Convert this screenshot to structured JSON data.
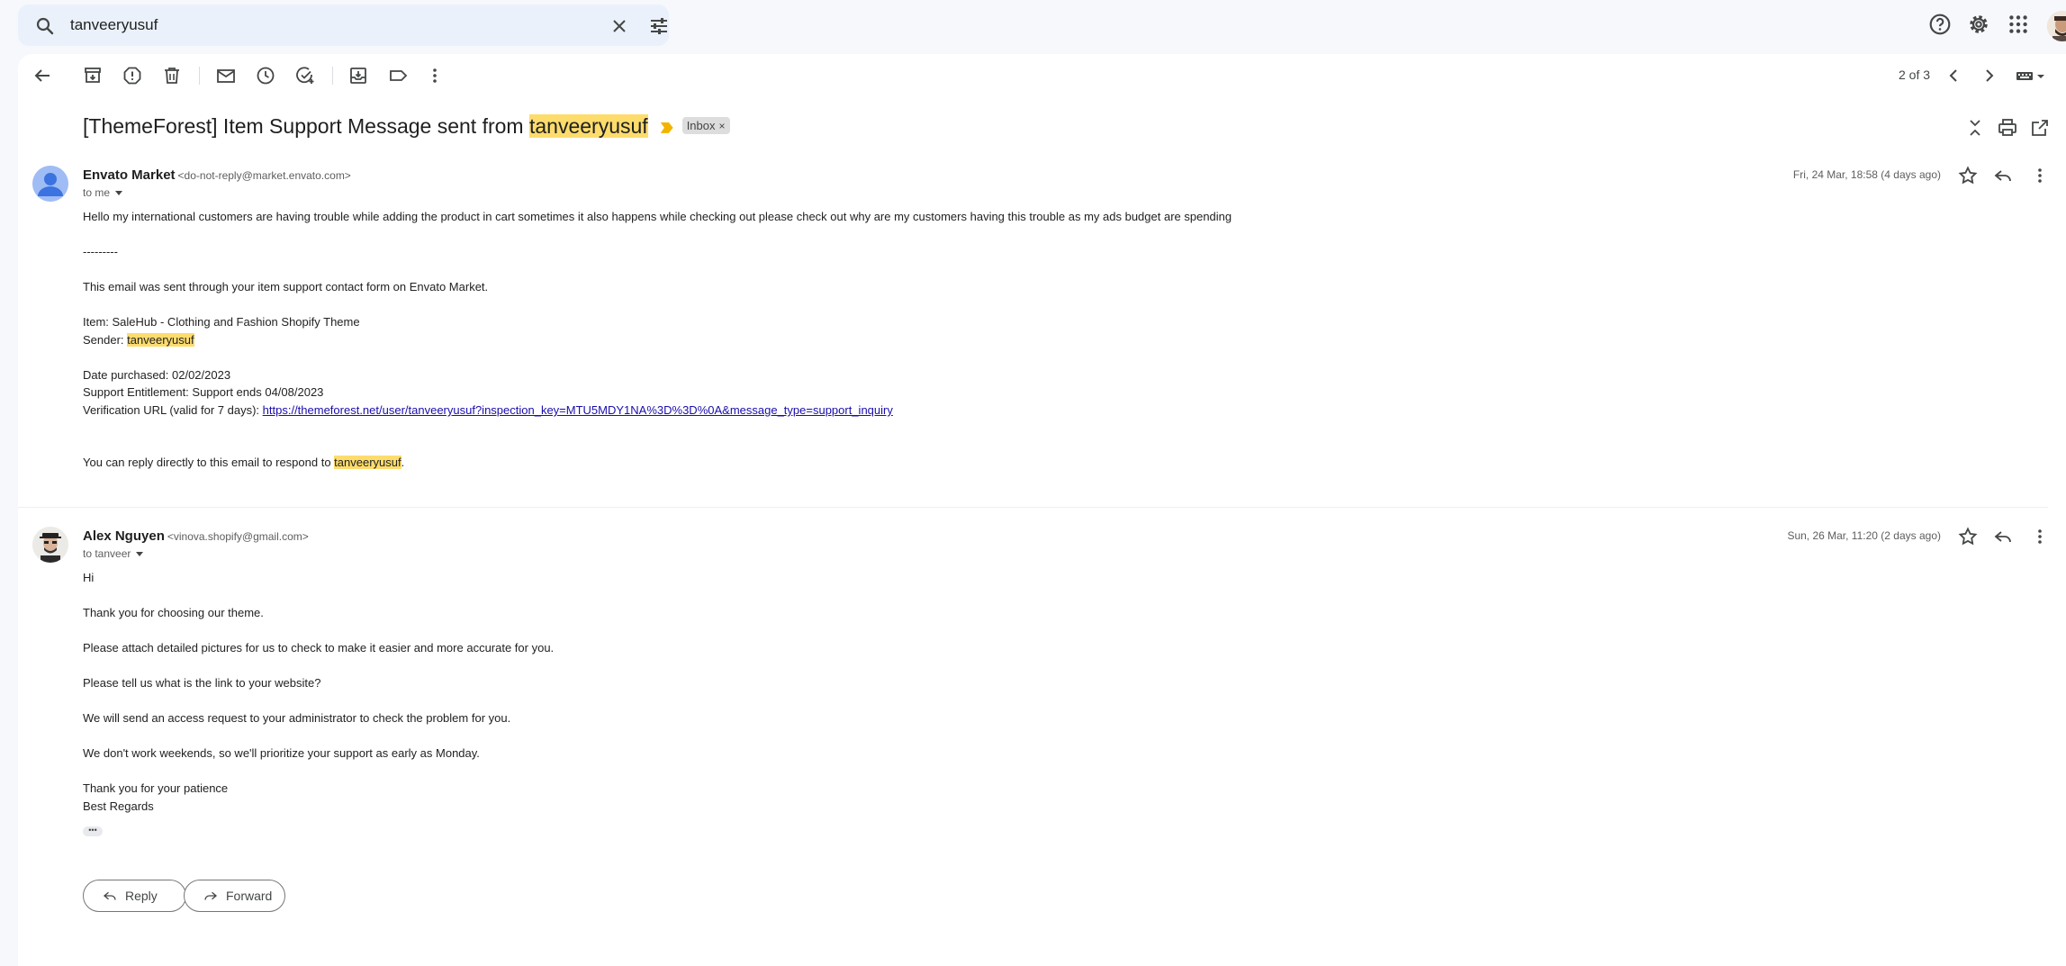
{
  "search": {
    "query": "tanveeryusuf"
  },
  "toolbar": {
    "pager": "2 of 3"
  },
  "thread": {
    "subject_prefix": "[ThemeForest] Item Support Message sent from ",
    "subject_highlight": "tanveeryusuf",
    "label_chip": "Inbox",
    "label_chip_close": "×"
  },
  "messages": [
    {
      "sender_name": "Envato Market",
      "sender_email": "<do-not-reply@market.envato.com>",
      "recipient": "to me",
      "date": "Fri, 24 Mar, 18:58 (4 days ago)",
      "lines": {
        "l1": "Hello my international customers are having trouble while adding the product in cart sometimes it also happens while checking out please check out why are my customers having this trouble as my ads budget are spending",
        "l2": "---------",
        "l3": "This email was sent through your item support contact form on Envato Market.",
        "l4": "Item: SaleHub - Clothing and Fashion Shopify Theme",
        "l5_prefix": "Sender: ",
        "l5_highlight": "tanveeryusuf",
        "l6": "Date purchased: 02/02/2023",
        "l7": "Support Entitlement: Support ends 04/08/2023",
        "l8_prefix": "Verification URL (valid for 7 days): ",
        "l8_link": "https://themeforest.net/user/tanveeryusuf?inspection_key=MTU5MDY1NA%3D%3D%0A&message_type=support_inquiry",
        "l9_prefix": "You can reply directly to this email to respond to ",
        "l9_highlight": "tanveeryusuf",
        "l9_suffix": "."
      }
    },
    {
      "sender_name": "Alex Nguyen",
      "sender_email": "<vinova.shopify@gmail.com>",
      "recipient": "to tanveer",
      "date": "Sun, 26 Mar, 11:20 (2 days ago)",
      "lines": {
        "l1": "Hi",
        "l2": "Thank you for choosing our theme.",
        "l3": "Please attach detailed pictures for us to check to make it easier and more accurate for you.",
        "l4": "Please tell us what is the link to your website?",
        "l5": "We will send an access request to your administrator to check the problem for you.",
        "l6": "We don't work weekends, so we'll prioritize your support as early as Monday.",
        "l7": "Thank you for your patience",
        "l8": "Best Regards"
      },
      "trimmed_content": "•••"
    }
  ],
  "actions": {
    "reply": "Reply",
    "forward": "Forward"
  },
  "icons": [
    "search-icon",
    "clear-search-icon",
    "search-options-icon",
    "help-icon",
    "settings-icon",
    "apps-grid-icon",
    "back-arrow-icon",
    "archive-icon",
    "report-spam-icon",
    "delete-icon",
    "mark-unread-icon",
    "snooze-icon",
    "add-to-tasks-icon",
    "move-to-icon",
    "label-icon",
    "more-vert-icon",
    "chevron-left-icon",
    "chevron-right-icon",
    "keyboard-icon",
    "collapse-all-icon",
    "print-icon",
    "open-new-window-icon",
    "star-icon",
    "reply-icon"
  ],
  "colors": {
    "highlight": "#fddc6c",
    "importance_marker": "#f2b400",
    "link": "#1a0dab",
    "search_bg": "#eaf1fb",
    "page_bg": "#f6f8fc"
  }
}
